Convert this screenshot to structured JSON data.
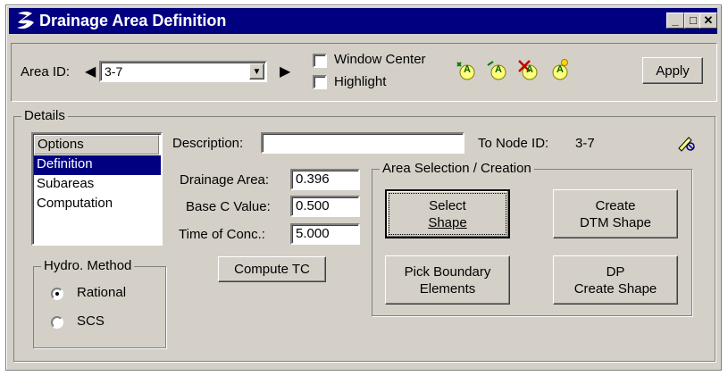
{
  "window": {
    "title": "Drainage Area Definition",
    "minimize_glyph": "_",
    "maximize_glyph": "□",
    "close_glyph": "✕"
  },
  "top_bar": {
    "area_id_label": "Area ID:",
    "area_id_value": "3-7",
    "prev_glyph": "◀",
    "next_glyph": "▶",
    "dropdown_glyph": "▼",
    "window_center_label": "Window Center",
    "highlight_label": "Highlight",
    "apply_label": "Apply",
    "tool_icons": [
      "add-area-icon",
      "edit-area-icon",
      "delete-area-icon",
      "new-area-icon"
    ],
    "tool_glyph": "A"
  },
  "details": {
    "legend": "Details",
    "options_header": "Options",
    "options": [
      "Definition",
      "Subareas",
      "Computation"
    ],
    "selected_option": 0,
    "description_label": "Description:",
    "description_value": "",
    "to_node_label": "To Node ID:",
    "to_node_value": "3-7",
    "drainage_area_label": "Drainage Area:",
    "drainage_area_value": "0.396",
    "base_c_label": "Base C Value:",
    "base_c_value": "0.500",
    "time_conc_label": "Time of Conc.:",
    "time_conc_value": "5.000",
    "compute_tc_label": "Compute TC",
    "hydro": {
      "legend": "Hydro. Method",
      "options": [
        "Rational",
        "SCS"
      ],
      "selected": 0
    },
    "area_selection": {
      "legend": "Area Selection / Creation",
      "select_shape": [
        "Select",
        "Shape"
      ],
      "create_dtm": [
        "Create",
        "DTM Shape"
      ],
      "pick_boundary": [
        "Pick Boundary",
        "Elements"
      ],
      "dp_create": [
        "DP",
        "Create Shape"
      ]
    }
  }
}
